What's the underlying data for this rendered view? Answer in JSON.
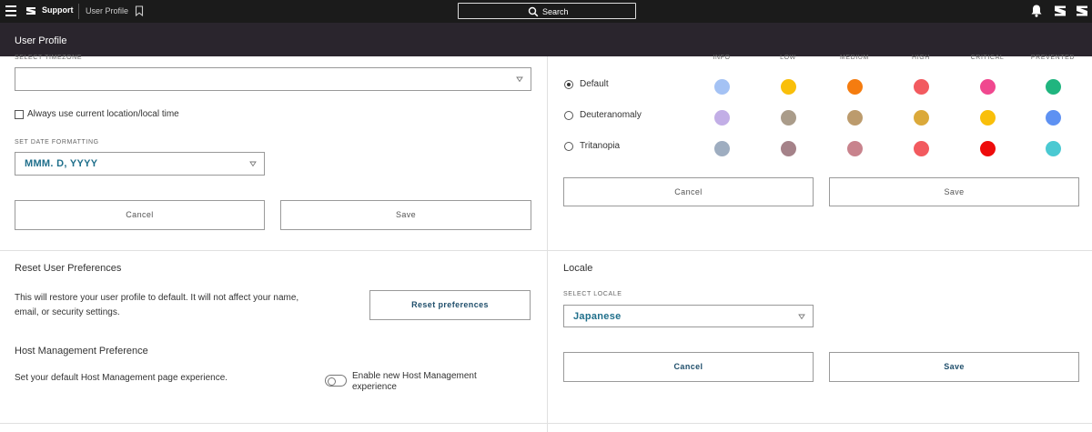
{
  "topbar": {
    "brand": "Support",
    "breadcrumb": "User Profile",
    "search_label": "Search"
  },
  "page_title": "User Profile",
  "timezone": {
    "label": "SELECT TIMEZONE",
    "value": "",
    "checkbox_label": "Always use current location/local time"
  },
  "date_format": {
    "label": "SET DATE FORMATTING",
    "value": "MMM. D, YYYY"
  },
  "left_actions": {
    "cancel": "Cancel",
    "save": "Save"
  },
  "reset": {
    "heading": "Reset User Preferences",
    "desc_line1": "This will restore your user profile to default. It will not affect your name,",
    "desc_line2": "email, or security settings.",
    "button": "Reset preferences"
  },
  "host_mgmt": {
    "heading": "Host Management Preference",
    "desc": "Set your default Host Management page experience.",
    "toggle_line1": "Enable new Host Management",
    "toggle_line2": "experience",
    "toggle_on": false
  },
  "color_scheme": {
    "columns": [
      "INFO",
      "LOW",
      "MEDIUM",
      "HIGH",
      "CRITICAL",
      "PREVENTED"
    ],
    "options": [
      {
        "label": "Default",
        "selected": true,
        "colors": [
          "#a4c2f4",
          "#f9bf0a",
          "#f57c0f",
          "#f25a5f",
          "#f0488f",
          "#20b57f"
        ]
      },
      {
        "label": "Deuteranomaly",
        "selected": false,
        "colors": [
          "#c2aee6",
          "#aa9c8a",
          "#bc9b6d",
          "#dba93a",
          "#f9bf0a",
          "#5e91f2"
        ]
      },
      {
        "label": "Tritanopia",
        "selected": false,
        "colors": [
          "#9eadc0",
          "#a58289",
          "#c8838d",
          "#f25a5f",
          "#ee0b0b",
          "#4ac9d2"
        ]
      }
    ],
    "cancel": "Cancel",
    "save": "Save"
  },
  "locale": {
    "heading": "Locale",
    "label": "SELECT LOCALE",
    "value": "Japanese",
    "cancel": "Cancel",
    "save": "Save"
  }
}
